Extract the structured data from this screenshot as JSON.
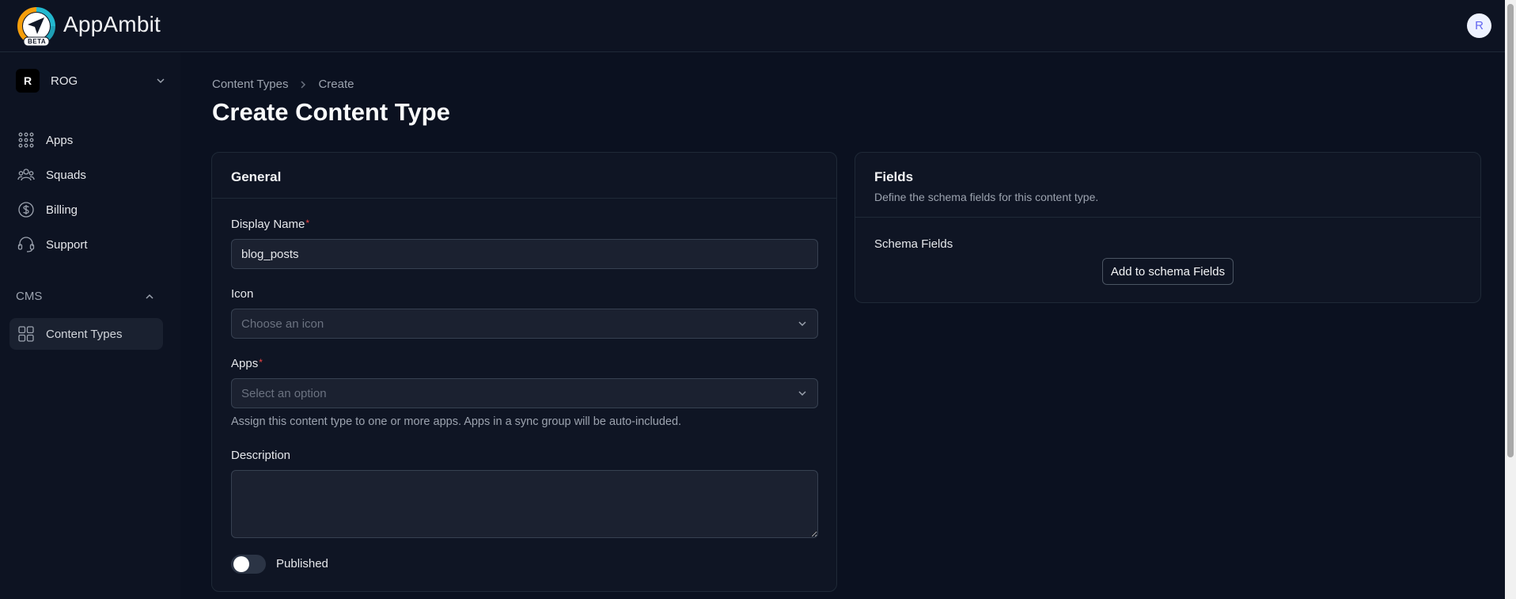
{
  "app": {
    "brand": "AppAmbit",
    "beta_badge": "BETA",
    "user_initial": "R"
  },
  "sidebar": {
    "org": {
      "initial": "R",
      "name": "ROG"
    },
    "items": [
      {
        "label": "Apps",
        "icon": "grid-dots-icon"
      },
      {
        "label": "Squads",
        "icon": "users-icon"
      },
      {
        "label": "Billing",
        "icon": "dollar-circle-icon"
      },
      {
        "label": "Support",
        "icon": "headset-icon"
      }
    ],
    "cms_section": {
      "label": "CMS",
      "items": [
        {
          "label": "Content Types",
          "icon": "squares-icon",
          "active": true
        }
      ]
    }
  },
  "breadcrumb": {
    "parent": "Content Types",
    "current": "Create"
  },
  "page_title": "Create Content Type",
  "general": {
    "title": "General",
    "display_name": {
      "label": "Display Name",
      "required": "*",
      "value": "blog_posts"
    },
    "icon": {
      "label": "Icon",
      "placeholder": "Choose an icon"
    },
    "apps": {
      "label": "Apps",
      "required": "*",
      "placeholder": "Select an option",
      "hint": "Assign this content type to one or more apps. Apps in a sync group will be auto-included."
    },
    "description": {
      "label": "Description",
      "value": ""
    },
    "published": {
      "label": "Published",
      "on": false
    }
  },
  "fields": {
    "title": "Fields",
    "subtitle": "Define the schema fields for this content type.",
    "schema_label": "Schema Fields",
    "add_button": "Add to schema Fields"
  },
  "colors": {
    "background": "#0b1120",
    "card": "#0f1524",
    "required": "#ef4444",
    "logo_orange": "#f59e0b",
    "logo_teal": "#22b8cf"
  }
}
